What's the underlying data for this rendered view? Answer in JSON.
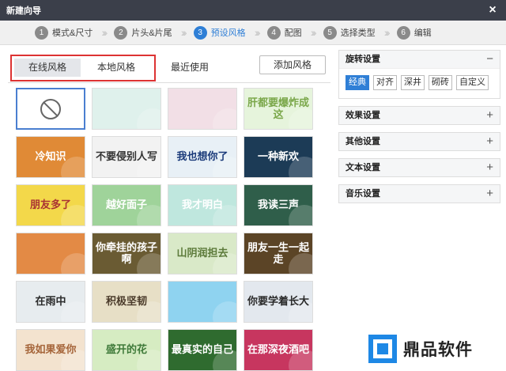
{
  "window": {
    "title": "新建向导",
    "close": "×"
  },
  "steps": [
    {
      "num": "1",
      "label": "模式&尺寸",
      "active": false
    },
    {
      "num": "2",
      "label": "片头&片尾",
      "active": false
    },
    {
      "num": "3",
      "label": "预设风格",
      "active": true
    },
    {
      "num": "4",
      "label": "配图",
      "active": false
    },
    {
      "num": "5",
      "label": "选择类型",
      "active": false
    },
    {
      "num": "6",
      "label": "编辑",
      "active": false
    }
  ],
  "tabs": {
    "online": "在线风格",
    "local": "本地风格",
    "recent": "最近使用",
    "add": "添加风格"
  },
  "grid": [
    {
      "text": "",
      "bg": "#ffffff",
      "fg": "#666",
      "none": true
    },
    {
      "text": "",
      "bg": "#dff1ec",
      "fg": "#444"
    },
    {
      "text": "",
      "bg": "#f2dfe6",
      "fg": "#fff"
    },
    {
      "text": "肝都要爆炸成这",
      "bg": "#e6f4dc",
      "fg": "#7aa74a"
    },
    {
      "text": "冷知识",
      "bg": "#e08a36",
      "fg": "#fff"
    },
    {
      "text": "不要侵别人写",
      "bg": "#f2f2f2",
      "fg": "#333"
    },
    {
      "text": "我也想你了",
      "bg": "#e8f0f6",
      "fg": "#1a3a7a"
    },
    {
      "text": "一种新欢",
      "bg": "#1c3b56",
      "fg": "#fff"
    },
    {
      "text": "朋友多了",
      "bg": "#f3d84a",
      "fg": "#a33"
    },
    {
      "text": "越好面子",
      "bg": "#9fd39a",
      "fg": "#fff"
    },
    {
      "text": "我才明白",
      "bg": "#bfe7de",
      "fg": "#fff"
    },
    {
      "text": "我读三声",
      "bg": "#2f5e4a",
      "fg": "#fff"
    },
    {
      "text": "",
      "bg": "#e38a45",
      "fg": "#fff"
    },
    {
      "text": "你牵挂的孩子啊",
      "bg": "#6a5b33",
      "fg": "#fff"
    },
    {
      "text": "山阴润担去",
      "bg": "#d9e9c8",
      "fg": "#5c7a3a"
    },
    {
      "text": "朋友一生一起走",
      "bg": "#5b4426",
      "fg": "#fff"
    },
    {
      "text": "在雨中",
      "bg": "#e7ecef",
      "fg": "#2a2a2a"
    },
    {
      "text": "积极坚韧",
      "bg": "#e7dfc6",
      "fg": "#4a3a2a"
    },
    {
      "text": "",
      "bg": "#8fd3f0",
      "fg": "#fff"
    },
    {
      "text": "你要学着长大",
      "bg": "#e3e8ee",
      "fg": "#2a2a2a"
    },
    {
      "text": "我如果爱你",
      "bg": "#f3e3cf",
      "fg": "#a5653a"
    },
    {
      "text": "盛开的花",
      "bg": "#d6ecc2",
      "fg": "#3f7a3a"
    },
    {
      "text": "最真实的自己",
      "bg": "#2f6b2f",
      "fg": "#fff"
    },
    {
      "text": "在那深夜酒吧",
      "bg": "#c7365f",
      "fg": "#fff"
    }
  ],
  "panels": {
    "rotate": {
      "title": "旋转设置",
      "toggle": "−",
      "options": [
        {
          "label": "经典",
          "on": true
        },
        {
          "label": "对齐",
          "on": false
        },
        {
          "label": "深井",
          "on": false
        },
        {
          "label": "砌砖",
          "on": false
        },
        {
          "label": "自定义",
          "on": false
        }
      ]
    },
    "effect": {
      "title": "效果设置",
      "toggle": "+"
    },
    "other": {
      "title": "其他设置",
      "toggle": "+"
    },
    "text": {
      "title": "文本设置",
      "toggle": "+"
    },
    "music": {
      "title": "音乐设置",
      "toggle": "+"
    }
  },
  "logo": {
    "text": "鼎品软件"
  },
  "colors": {
    "accent": "#2f7fd6",
    "highlight_box": "#dd3333",
    "titlebar": "#3b3f4a"
  }
}
